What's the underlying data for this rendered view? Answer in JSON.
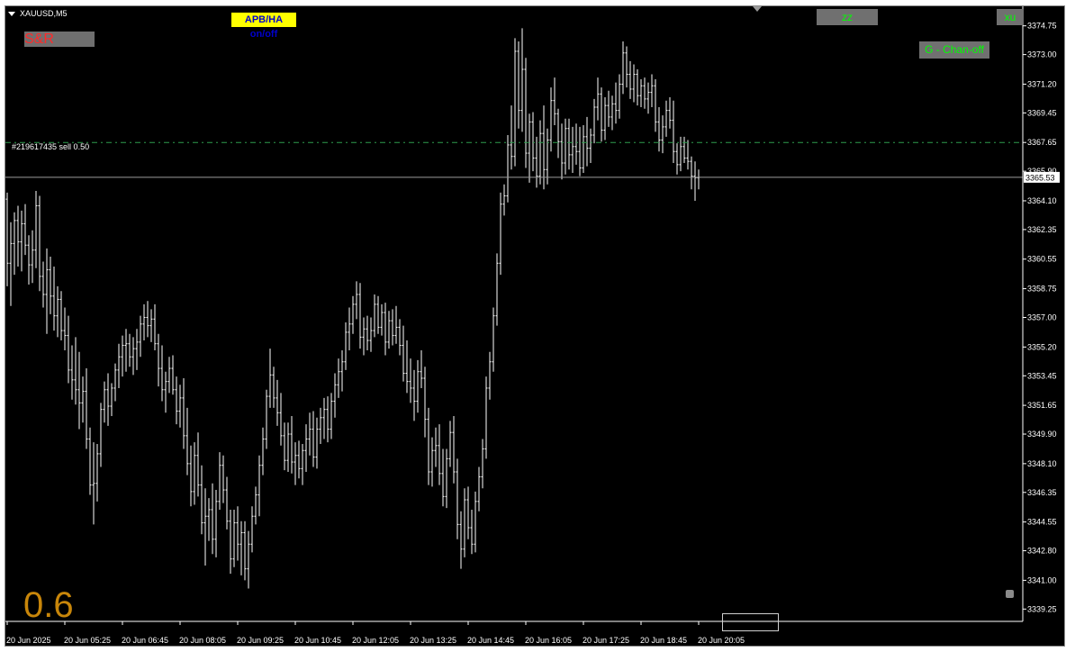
{
  "window": {
    "symbol": "XAUUSD,M5"
  },
  "buttons": {
    "sr": "S&R",
    "apb": "APB/HA on/off",
    "zz": "zz",
    "xu": "xu",
    "chan": "G - Chan-off"
  },
  "order": {
    "label": "#219617435 sell 0.50",
    "price": 3367.65
  },
  "overlay_value": "0.6",
  "current_price": {
    "label": "3365.53",
    "value": 3365.53
  },
  "colors": {
    "background": "#000000",
    "candles": "#ffffff",
    "order_line": "#2e9e4e",
    "bid_line": "#9a9a9a",
    "accent_number": "#c8860a"
  },
  "chart_data": {
    "type": "ohlc",
    "symbol": "XAUUSD",
    "timeframe": "M5",
    "ylim": [
      3338.5,
      3375.5
    ],
    "y_ticks": [
      "3374.75",
      "3373.00",
      "3371.20",
      "3369.45",
      "3367.65",
      "3365.90",
      "3364.10",
      "3362.35",
      "3360.55",
      "3358.75",
      "3357.00",
      "3355.20",
      "3353.45",
      "3351.65",
      "3349.90",
      "3348.10",
      "3346.35",
      "3344.55",
      "3342.80",
      "3341.00",
      "3339.25"
    ],
    "x_ticks": [
      "20 Jun 2025",
      "20 Jun 05:25",
      "20 Jun 06:45",
      "20 Jun 08:05",
      "20 Jun 09:25",
      "20 Jun 10:45",
      "20 Jun 12:05",
      "20 Jun 13:25",
      "20 Jun 14:45",
      "20 Jun 16:05",
      "20 Jun 17:25",
      "20 Jun 18:45",
      "20 Jun 20:05"
    ],
    "x_tick_index": [
      0,
      16,
      32,
      48,
      64,
      80,
      96,
      112,
      128,
      144,
      160,
      176,
      192
    ],
    "ohlc": [
      [
        3364.2,
        3364.6,
        3358.9,
        3360.3
      ],
      [
        3360.3,
        3362.8,
        3357.7,
        3361.5
      ],
      [
        3361.5,
        3363.4,
        3359.6,
        3362.9
      ],
      [
        3362.9,
        3363.8,
        3360.1,
        3361.6
      ],
      [
        3361.6,
        3363.5,
        3359.8,
        3362.7
      ],
      [
        3362.7,
        3363.9,
        3360.8,
        3361.4
      ],
      [
        3361.4,
        3362.0,
        3359.0,
        3360.2
      ],
      [
        3360.2,
        3362.3,
        3359.1,
        3361.1
      ],
      [
        3361.1,
        3364.7,
        3360.0,
        3363.8
      ],
      [
        3363.8,
        3364.4,
        3358.6,
        3359.5
      ],
      [
        3359.5,
        3360.4,
        3357.6,
        3358.4
      ],
      [
        3358.4,
        3361.2,
        3356.0,
        3359.9
      ],
      [
        3359.9,
        3360.7,
        3357.2,
        3358.3
      ],
      [
        3358.3,
        3360.1,
        3356.2,
        3357.1
      ],
      [
        3357.1,
        3358.9,
        3355.8,
        3358.1
      ],
      [
        3358.1,
        3358.6,
        3355.6,
        3356.2
      ],
      [
        3356.2,
        3357.6,
        3355.0,
        3355.9
      ],
      [
        3355.9,
        3357.1,
        3353.0,
        3353.8
      ],
      [
        3353.8,
        3355.3,
        3352.0,
        3353.2
      ],
      [
        3353.2,
        3355.8,
        3351.7,
        3352.6
      ],
      [
        3352.6,
        3354.9,
        3350.2,
        3351.8
      ],
      [
        3351.8,
        3353.4,
        3350.6,
        3352.5
      ],
      [
        3352.5,
        3353.9,
        3349.0,
        3349.6
      ],
      [
        3349.6,
        3350.3,
        3346.2,
        3346.8
      ],
      [
        3346.8,
        3349.4,
        3344.4,
        3346.9
      ],
      [
        3346.9,
        3349.3,
        3345.8,
        3348.7
      ],
      [
        3348.7,
        3351.8,
        3347.9,
        3351.4
      ],
      [
        3351.4,
        3353.1,
        3350.6,
        3352.6
      ],
      [
        3352.6,
        3353.6,
        3350.4,
        3351.6
      ],
      [
        3351.6,
        3353.0,
        3351.0,
        3352.7
      ],
      [
        3352.7,
        3354.2,
        3351.9,
        3353.8
      ],
      [
        3353.8,
        3355.4,
        3352.7,
        3354.6
      ],
      [
        3354.6,
        3355.9,
        3353.4,
        3355.3
      ],
      [
        3355.3,
        3356.3,
        3353.7,
        3355.4
      ],
      [
        3355.4,
        3356.0,
        3354.0,
        3354.6
      ],
      [
        3354.6,
        3355.8,
        3353.5,
        3355.1
      ],
      [
        3355.1,
        3356.3,
        3353.8,
        3355.5
      ],
      [
        3355.5,
        3357.1,
        3354.6,
        3356.6
      ],
      [
        3356.6,
        3357.8,
        3355.6,
        3357.0
      ],
      [
        3357.0,
        3358.0,
        3355.8,
        3356.5
      ],
      [
        3356.5,
        3357.5,
        3355.5,
        3356.9
      ],
      [
        3356.9,
        3357.8,
        3355.0,
        3355.4
      ],
      [
        3355.4,
        3356.0,
        3352.8,
        3353.9
      ],
      [
        3353.9,
        3355.3,
        3351.9,
        3352.6
      ],
      [
        3352.6,
        3353.7,
        3351.2,
        3353.1
      ],
      [
        3353.1,
        3354.6,
        3352.4,
        3353.9
      ],
      [
        3353.9,
        3354.7,
        3352.3,
        3352.6
      ],
      [
        3352.6,
        3353.4,
        3350.5,
        3351.3
      ],
      [
        3351.3,
        3352.9,
        3350.3,
        3352.1
      ],
      [
        3352.1,
        3353.3,
        3349.0,
        3349.8
      ],
      [
        3349.8,
        3351.5,
        3347.4,
        3348.1
      ],
      [
        3348.1,
        3349.2,
        3345.5,
        3346.4
      ],
      [
        3346.4,
        3349.4,
        3345.6,
        3348.6
      ],
      [
        3348.6,
        3350.0,
        3346.1,
        3346.8
      ],
      [
        3346.8,
        3348.0,
        3343.8,
        3344.5
      ],
      [
        3344.5,
        3346.6,
        3341.9,
        3344.9
      ],
      [
        3344.9,
        3346.0,
        3343.4,
        3345.3
      ],
      [
        3345.3,
        3346.9,
        3342.6,
        3343.5
      ],
      [
        3343.5,
        3346.5,
        3342.4,
        3345.8
      ],
      [
        3345.8,
        3348.8,
        3345.3,
        3348.0
      ],
      [
        3348.0,
        3348.6,
        3345.7,
        3346.5
      ],
      [
        3346.5,
        3347.3,
        3344.1,
        3344.6
      ],
      [
        3344.6,
        3345.3,
        3341.4,
        3342.3
      ],
      [
        3342.3,
        3345.3,
        3341.8,
        3344.5
      ],
      [
        3344.5,
        3345.5,
        3342.2,
        3343.2
      ],
      [
        3343.2,
        3344.6,
        3341.3,
        3343.9
      ],
      [
        3343.9,
        3344.6,
        3341.0,
        3341.7
      ],
      [
        3341.7,
        3344.0,
        3340.5,
        3343.2
      ],
      [
        3343.2,
        3345.5,
        3342.7,
        3344.9
      ],
      [
        3344.9,
        3346.7,
        3344.4,
        3346.2
      ],
      [
        3346.2,
        3348.6,
        3344.9,
        3348.0
      ],
      [
        3348.0,
        3350.3,
        3347.4,
        3349.6
      ],
      [
        3349.6,
        3352.6,
        3349.0,
        3352.2
      ],
      [
        3352.2,
        3355.1,
        3351.5,
        3353.5
      ],
      [
        3353.5,
        3354.0,
        3351.5,
        3352.1
      ],
      [
        3352.1,
        3353.2,
        3350.4,
        3351.2
      ],
      [
        3351.2,
        3352.4,
        3349.2,
        3349.8
      ],
      [
        3349.8,
        3350.6,
        3347.7,
        3348.3
      ],
      [
        3348.3,
        3350.6,
        3347.6,
        3349.9
      ],
      [
        3349.9,
        3351.0,
        3347.5,
        3348.2
      ],
      [
        3348.2,
        3349.4,
        3346.8,
        3348.6
      ],
      [
        3348.6,
        3349.5,
        3347.2,
        3347.8
      ],
      [
        3347.8,
        3349.3,
        3346.8,
        3348.9
      ],
      [
        3348.9,
        3350.5,
        3347.6,
        3349.6
      ],
      [
        3349.6,
        3351.2,
        3348.6,
        3350.2
      ],
      [
        3350.2,
        3351.3,
        3347.9,
        3348.5
      ],
      [
        3348.5,
        3350.9,
        3347.8,
        3350.2
      ],
      [
        3350.2,
        3351.5,
        3349.3,
        3350.9
      ],
      [
        3350.9,
        3352.1,
        3349.6,
        3351.4
      ],
      [
        3351.4,
        3352.2,
        3349.4,
        3350.2
      ],
      [
        3350.2,
        3352.4,
        3349.6,
        3351.9
      ],
      [
        3351.9,
        3353.6,
        3350.9,
        3352.9
      ],
      [
        3352.9,
        3354.5,
        3352.1,
        3353.7
      ],
      [
        3353.7,
        3355.0,
        3352.5,
        3354.3
      ],
      [
        3354.3,
        3356.7,
        3353.8,
        3356.1
      ],
      [
        3356.1,
        3357.6,
        3355.0,
        3356.6
      ],
      [
        3356.6,
        3358.3,
        3356.0,
        3357.8
      ],
      [
        3357.8,
        3359.2,
        3356.9,
        3358.4
      ],
      [
        3358.4,
        3359.1,
        3355.1,
        3355.8
      ],
      [
        3355.8,
        3357.0,
        3354.7,
        3356.3
      ],
      [
        3356.3,
        3357.1,
        3355.0,
        3355.6
      ],
      [
        3355.6,
        3357.0,
        3354.9,
        3356.2
      ],
      [
        3356.2,
        3358.4,
        3355.8,
        3357.8
      ],
      [
        3357.8,
        3358.3,
        3356.0,
        3356.4
      ],
      [
        3356.4,
        3357.8,
        3355.9,
        3357.3
      ],
      [
        3357.3,
        3357.9,
        3354.7,
        3355.5
      ],
      [
        3355.5,
        3357.4,
        3355.1,
        3356.8
      ],
      [
        3356.8,
        3357.5,
        3355.3,
        3355.9
      ],
      [
        3355.9,
        3357.7,
        3355.4,
        3356.4
      ],
      [
        3356.4,
        3356.9,
        3354.7,
        3355.3
      ],
      [
        3355.3,
        3356.5,
        3353.1,
        3353.6
      ],
      [
        3353.6,
        3355.6,
        3352.4,
        3353.1
      ],
      [
        3353.1,
        3354.5,
        3351.8,
        3352.7
      ],
      [
        3352.7,
        3353.8,
        3350.7,
        3351.9
      ],
      [
        3351.9,
        3354.4,
        3351.2,
        3353.7
      ],
      [
        3353.7,
        3355.0,
        3352.7,
        3353.3
      ],
      [
        3353.3,
        3354.0,
        3349.7,
        3350.8
      ],
      [
        3350.8,
        3351.5,
        3346.8,
        3347.6
      ],
      [
        3347.6,
        3349.7,
        3346.7,
        3348.9
      ],
      [
        3348.9,
        3350.3,
        3347.9,
        3349.2
      ],
      [
        3349.2,
        3350.5,
        3346.8,
        3347.5
      ],
      [
        3347.5,
        3349.0,
        3345.5,
        3346.1
      ],
      [
        3346.1,
        3349.0,
        3345.4,
        3348.4
      ],
      [
        3348.4,
        3350.7,
        3347.9,
        3350.0
      ],
      [
        3350.0,
        3351.0,
        3346.9,
        3347.6
      ],
      [
        3347.6,
        3348.4,
        3343.5,
        3344.4
      ],
      [
        3344.4,
        3345.2,
        3341.7,
        3342.9
      ],
      [
        3342.9,
        3346.6,
        3342.4,
        3345.9
      ],
      [
        3345.9,
        3346.7,
        3343.5,
        3344.2
      ],
      [
        3344.2,
        3345.3,
        3342.6,
        3343.2
      ],
      [
        3343.2,
        3346.4,
        3342.7,
        3345.8
      ],
      [
        3345.8,
        3347.9,
        3345.2,
        3347.3
      ],
      [
        3347.3,
        3349.6,
        3346.6,
        3349.0
      ],
      [
        3349.0,
        3353.4,
        3348.4,
        3352.7
      ],
      [
        3352.7,
        3354.9,
        3352.0,
        3354.3
      ],
      [
        3354.3,
        3357.6,
        3353.7,
        3357.1
      ],
      [
        3357.1,
        3360.9,
        3356.5,
        3360.3
      ],
      [
        3360.3,
        3364.6,
        3359.6,
        3363.9
      ],
      [
        3363.9,
        3365.1,
        3363.2,
        3364.4
      ],
      [
        3364.4,
        3368.1,
        3364.0,
        3367.5
      ],
      [
        3367.5,
        3369.9,
        3366.0,
        3366.8
      ],
      [
        3366.8,
        3374.0,
        3366.2,
        3373.2
      ],
      [
        3373.2,
        3373.8,
        3368.5,
        3369.6
      ],
      [
        3369.6,
        3374.6,
        3368.3,
        3372.1
      ],
      [
        3372.1,
        3372.8,
        3366.1,
        3367.0
      ],
      [
        3367.0,
        3369.4,
        3365.2,
        3368.9
      ],
      [
        3368.9,
        3369.5,
        3365.9,
        3366.7
      ],
      [
        3366.7,
        3368.0,
        3364.9,
        3365.6
      ],
      [
        3365.6,
        3369.0,
        3365.1,
        3368.2
      ],
      [
        3368.2,
        3369.9,
        3364.8,
        3366.0
      ],
      [
        3366.0,
        3368.5,
        3365.1,
        3367.8
      ],
      [
        3367.8,
        3371.0,
        3367.1,
        3370.2
      ],
      [
        3370.2,
        3371.6,
        3368.7,
        3369.4
      ],
      [
        3369.4,
        3369.7,
        3366.7,
        3367.7
      ],
      [
        3367.7,
        3368.8,
        3365.4,
        3366.4
      ],
      [
        3366.4,
        3369.1,
        3365.7,
        3368.5
      ],
      [
        3368.5,
        3369.1,
        3366.0,
        3366.9
      ],
      [
        3366.9,
        3368.6,
        3365.8,
        3367.4
      ],
      [
        3367.4,
        3368.8,
        3366.3,
        3367.1
      ],
      [
        3367.1,
        3368.6,
        3365.6,
        3366.1
      ],
      [
        3366.1,
        3368.7,
        3365.8,
        3368.0
      ],
      [
        3368.0,
        3369.2,
        3366.2,
        3367.3
      ],
      [
        3367.3,
        3368.5,
        3366.4,
        3368.1
      ],
      [
        3368.1,
        3370.3,
        3367.6,
        3369.8
      ],
      [
        3369.8,
        3371.6,
        3369.0,
        3370.6
      ],
      [
        3370.6,
        3371.0,
        3367.7,
        3368.4
      ],
      [
        3368.4,
        3370.4,
        3367.8,
        3369.9
      ],
      [
        3369.9,
        3370.8,
        3368.6,
        3369.2
      ],
      [
        3369.2,
        3370.5,
        3368.4,
        3370.0
      ],
      [
        3370.0,
        3371.3,
        3368.8,
        3369.6
      ],
      [
        3369.6,
        3371.8,
        3369.1,
        3371.2
      ],
      [
        3371.2,
        3373.8,
        3370.6,
        3373.1
      ],
      [
        3373.1,
        3373.5,
        3371.0,
        3371.8
      ],
      [
        3371.8,
        3372.6,
        3370.3,
        3370.9
      ],
      [
        3370.9,
        3372.4,
        3370.1,
        3371.8
      ],
      [
        3371.8,
        3372.1,
        3369.9,
        3370.5
      ],
      [
        3370.5,
        3371.5,
        3369.8,
        3371.1
      ],
      [
        3371.1,
        3371.6,
        3369.7,
        3370.3
      ],
      [
        3370.3,
        3371.3,
        3369.4,
        3370.7
      ],
      [
        3370.7,
        3371.8,
        3369.8,
        3371.1
      ],
      [
        3371.1,
        3371.5,
        3368.3,
        3368.9
      ],
      [
        3368.9,
        3369.8,
        3367.1,
        3367.8
      ],
      [
        3367.8,
        3369.3,
        3367.0,
        3368.6
      ],
      [
        3368.6,
        3370.2,
        3368.0,
        3369.6
      ],
      [
        3369.6,
        3370.4,
        3368.5,
        3369.0
      ],
      [
        3369.0,
        3370.2,
        3366.4,
        3367.1
      ],
      [
        3367.1,
        3367.6,
        3365.7,
        3366.3
      ],
      [
        3366.3,
        3368.0,
        3365.9,
        3367.4
      ],
      [
        3367.4,
        3368.0,
        3366.4,
        3366.7
      ],
      [
        3366.7,
        3367.8,
        3366.0,
        3366.5
      ],
      [
        3366.5,
        3366.8,
        3364.8,
        3365.6
      ],
      [
        3365.6,
        3366.5,
        3364.1,
        3365.5
      ],
      [
        3365.5,
        3366.0,
        3364.8,
        3365.53
      ]
    ]
  }
}
